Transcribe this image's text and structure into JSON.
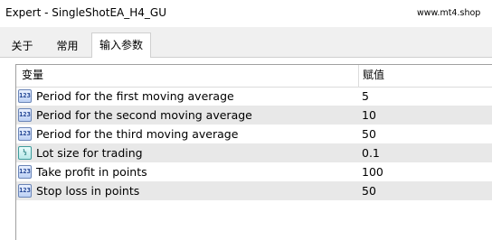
{
  "window": {
    "title": "Expert - SingleShotEA_H4_GU",
    "watermark": "www.mt4.shop"
  },
  "tabs": [
    {
      "label": "关于"
    },
    {
      "label": "常用"
    },
    {
      "label": "输入参数",
      "active": true
    }
  ],
  "table": {
    "columns": [
      "变量",
      "赋值"
    ],
    "rows": [
      {
        "icon": "integer-param-icon",
        "icon_text": "123",
        "name": "Period for the first moving average",
        "value": "5"
      },
      {
        "icon": "integer-param-icon",
        "icon_text": "123",
        "name": "Period for the second moving average",
        "value": "10"
      },
      {
        "icon": "integer-param-icon",
        "icon_text": "123",
        "name": "Period for the third moving average",
        "value": "50"
      },
      {
        "icon": "double-param-icon",
        "icon_text": "½",
        "name": "Lot size for trading",
        "value": "0.1"
      },
      {
        "icon": "integer-param-icon",
        "icon_text": "123",
        "name": "Take profit in points",
        "value": "100"
      },
      {
        "icon": "integer-param-icon",
        "icon_text": "123",
        "name": "Stop loss in points",
        "value": "50"
      }
    ]
  }
}
